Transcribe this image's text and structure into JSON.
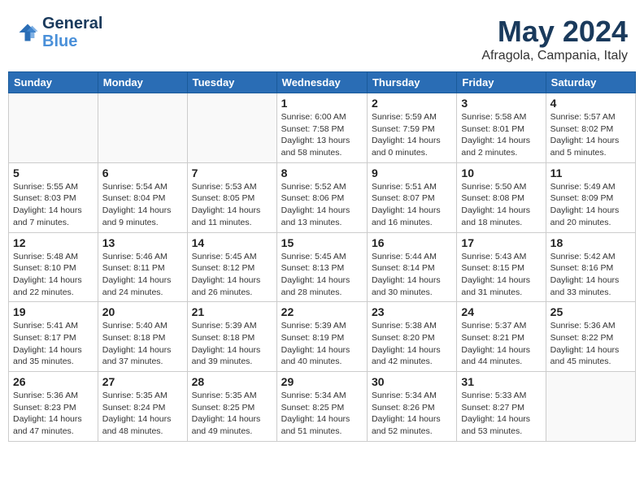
{
  "header": {
    "logo_general": "General",
    "logo_blue": "Blue",
    "month_title": "May 2024",
    "location": "Afragola, Campania, Italy"
  },
  "weekdays": [
    "Sunday",
    "Monday",
    "Tuesday",
    "Wednesday",
    "Thursday",
    "Friday",
    "Saturday"
  ],
  "weeks": [
    [
      {
        "day": "",
        "sunrise": "",
        "sunset": "",
        "daylight": ""
      },
      {
        "day": "",
        "sunrise": "",
        "sunset": "",
        "daylight": ""
      },
      {
        "day": "",
        "sunrise": "",
        "sunset": "",
        "daylight": ""
      },
      {
        "day": "1",
        "sunrise": "Sunrise: 6:00 AM",
        "sunset": "Sunset: 7:58 PM",
        "daylight": "Daylight: 13 hours and 58 minutes."
      },
      {
        "day": "2",
        "sunrise": "Sunrise: 5:59 AM",
        "sunset": "Sunset: 7:59 PM",
        "daylight": "Daylight: 14 hours and 0 minutes."
      },
      {
        "day": "3",
        "sunrise": "Sunrise: 5:58 AM",
        "sunset": "Sunset: 8:01 PM",
        "daylight": "Daylight: 14 hours and 2 minutes."
      },
      {
        "day": "4",
        "sunrise": "Sunrise: 5:57 AM",
        "sunset": "Sunset: 8:02 PM",
        "daylight": "Daylight: 14 hours and 5 minutes."
      }
    ],
    [
      {
        "day": "5",
        "sunrise": "Sunrise: 5:55 AM",
        "sunset": "Sunset: 8:03 PM",
        "daylight": "Daylight: 14 hours and 7 minutes."
      },
      {
        "day": "6",
        "sunrise": "Sunrise: 5:54 AM",
        "sunset": "Sunset: 8:04 PM",
        "daylight": "Daylight: 14 hours and 9 minutes."
      },
      {
        "day": "7",
        "sunrise": "Sunrise: 5:53 AM",
        "sunset": "Sunset: 8:05 PM",
        "daylight": "Daylight: 14 hours and 11 minutes."
      },
      {
        "day": "8",
        "sunrise": "Sunrise: 5:52 AM",
        "sunset": "Sunset: 8:06 PM",
        "daylight": "Daylight: 14 hours and 13 minutes."
      },
      {
        "day": "9",
        "sunrise": "Sunrise: 5:51 AM",
        "sunset": "Sunset: 8:07 PM",
        "daylight": "Daylight: 14 hours and 16 minutes."
      },
      {
        "day": "10",
        "sunrise": "Sunrise: 5:50 AM",
        "sunset": "Sunset: 8:08 PM",
        "daylight": "Daylight: 14 hours and 18 minutes."
      },
      {
        "day": "11",
        "sunrise": "Sunrise: 5:49 AM",
        "sunset": "Sunset: 8:09 PM",
        "daylight": "Daylight: 14 hours and 20 minutes."
      }
    ],
    [
      {
        "day": "12",
        "sunrise": "Sunrise: 5:48 AM",
        "sunset": "Sunset: 8:10 PM",
        "daylight": "Daylight: 14 hours and 22 minutes."
      },
      {
        "day": "13",
        "sunrise": "Sunrise: 5:46 AM",
        "sunset": "Sunset: 8:11 PM",
        "daylight": "Daylight: 14 hours and 24 minutes."
      },
      {
        "day": "14",
        "sunrise": "Sunrise: 5:45 AM",
        "sunset": "Sunset: 8:12 PM",
        "daylight": "Daylight: 14 hours and 26 minutes."
      },
      {
        "day": "15",
        "sunrise": "Sunrise: 5:45 AM",
        "sunset": "Sunset: 8:13 PM",
        "daylight": "Daylight: 14 hours and 28 minutes."
      },
      {
        "day": "16",
        "sunrise": "Sunrise: 5:44 AM",
        "sunset": "Sunset: 8:14 PM",
        "daylight": "Daylight: 14 hours and 30 minutes."
      },
      {
        "day": "17",
        "sunrise": "Sunrise: 5:43 AM",
        "sunset": "Sunset: 8:15 PM",
        "daylight": "Daylight: 14 hours and 31 minutes."
      },
      {
        "day": "18",
        "sunrise": "Sunrise: 5:42 AM",
        "sunset": "Sunset: 8:16 PM",
        "daylight": "Daylight: 14 hours and 33 minutes."
      }
    ],
    [
      {
        "day": "19",
        "sunrise": "Sunrise: 5:41 AM",
        "sunset": "Sunset: 8:17 PM",
        "daylight": "Daylight: 14 hours and 35 minutes."
      },
      {
        "day": "20",
        "sunrise": "Sunrise: 5:40 AM",
        "sunset": "Sunset: 8:18 PM",
        "daylight": "Daylight: 14 hours and 37 minutes."
      },
      {
        "day": "21",
        "sunrise": "Sunrise: 5:39 AM",
        "sunset": "Sunset: 8:18 PM",
        "daylight": "Daylight: 14 hours and 39 minutes."
      },
      {
        "day": "22",
        "sunrise": "Sunrise: 5:39 AM",
        "sunset": "Sunset: 8:19 PM",
        "daylight": "Daylight: 14 hours and 40 minutes."
      },
      {
        "day": "23",
        "sunrise": "Sunrise: 5:38 AM",
        "sunset": "Sunset: 8:20 PM",
        "daylight": "Daylight: 14 hours and 42 minutes."
      },
      {
        "day": "24",
        "sunrise": "Sunrise: 5:37 AM",
        "sunset": "Sunset: 8:21 PM",
        "daylight": "Daylight: 14 hours and 44 minutes."
      },
      {
        "day": "25",
        "sunrise": "Sunrise: 5:36 AM",
        "sunset": "Sunset: 8:22 PM",
        "daylight": "Daylight: 14 hours and 45 minutes."
      }
    ],
    [
      {
        "day": "26",
        "sunrise": "Sunrise: 5:36 AM",
        "sunset": "Sunset: 8:23 PM",
        "daylight": "Daylight: 14 hours and 47 minutes."
      },
      {
        "day": "27",
        "sunrise": "Sunrise: 5:35 AM",
        "sunset": "Sunset: 8:24 PM",
        "daylight": "Daylight: 14 hours and 48 minutes."
      },
      {
        "day": "28",
        "sunrise": "Sunrise: 5:35 AM",
        "sunset": "Sunset: 8:25 PM",
        "daylight": "Daylight: 14 hours and 49 minutes."
      },
      {
        "day": "29",
        "sunrise": "Sunrise: 5:34 AM",
        "sunset": "Sunset: 8:25 PM",
        "daylight": "Daylight: 14 hours and 51 minutes."
      },
      {
        "day": "30",
        "sunrise": "Sunrise: 5:34 AM",
        "sunset": "Sunset: 8:26 PM",
        "daylight": "Daylight: 14 hours and 52 minutes."
      },
      {
        "day": "31",
        "sunrise": "Sunrise: 5:33 AM",
        "sunset": "Sunset: 8:27 PM",
        "daylight": "Daylight: 14 hours and 53 minutes."
      },
      {
        "day": "",
        "sunrise": "",
        "sunset": "",
        "daylight": ""
      }
    ]
  ]
}
